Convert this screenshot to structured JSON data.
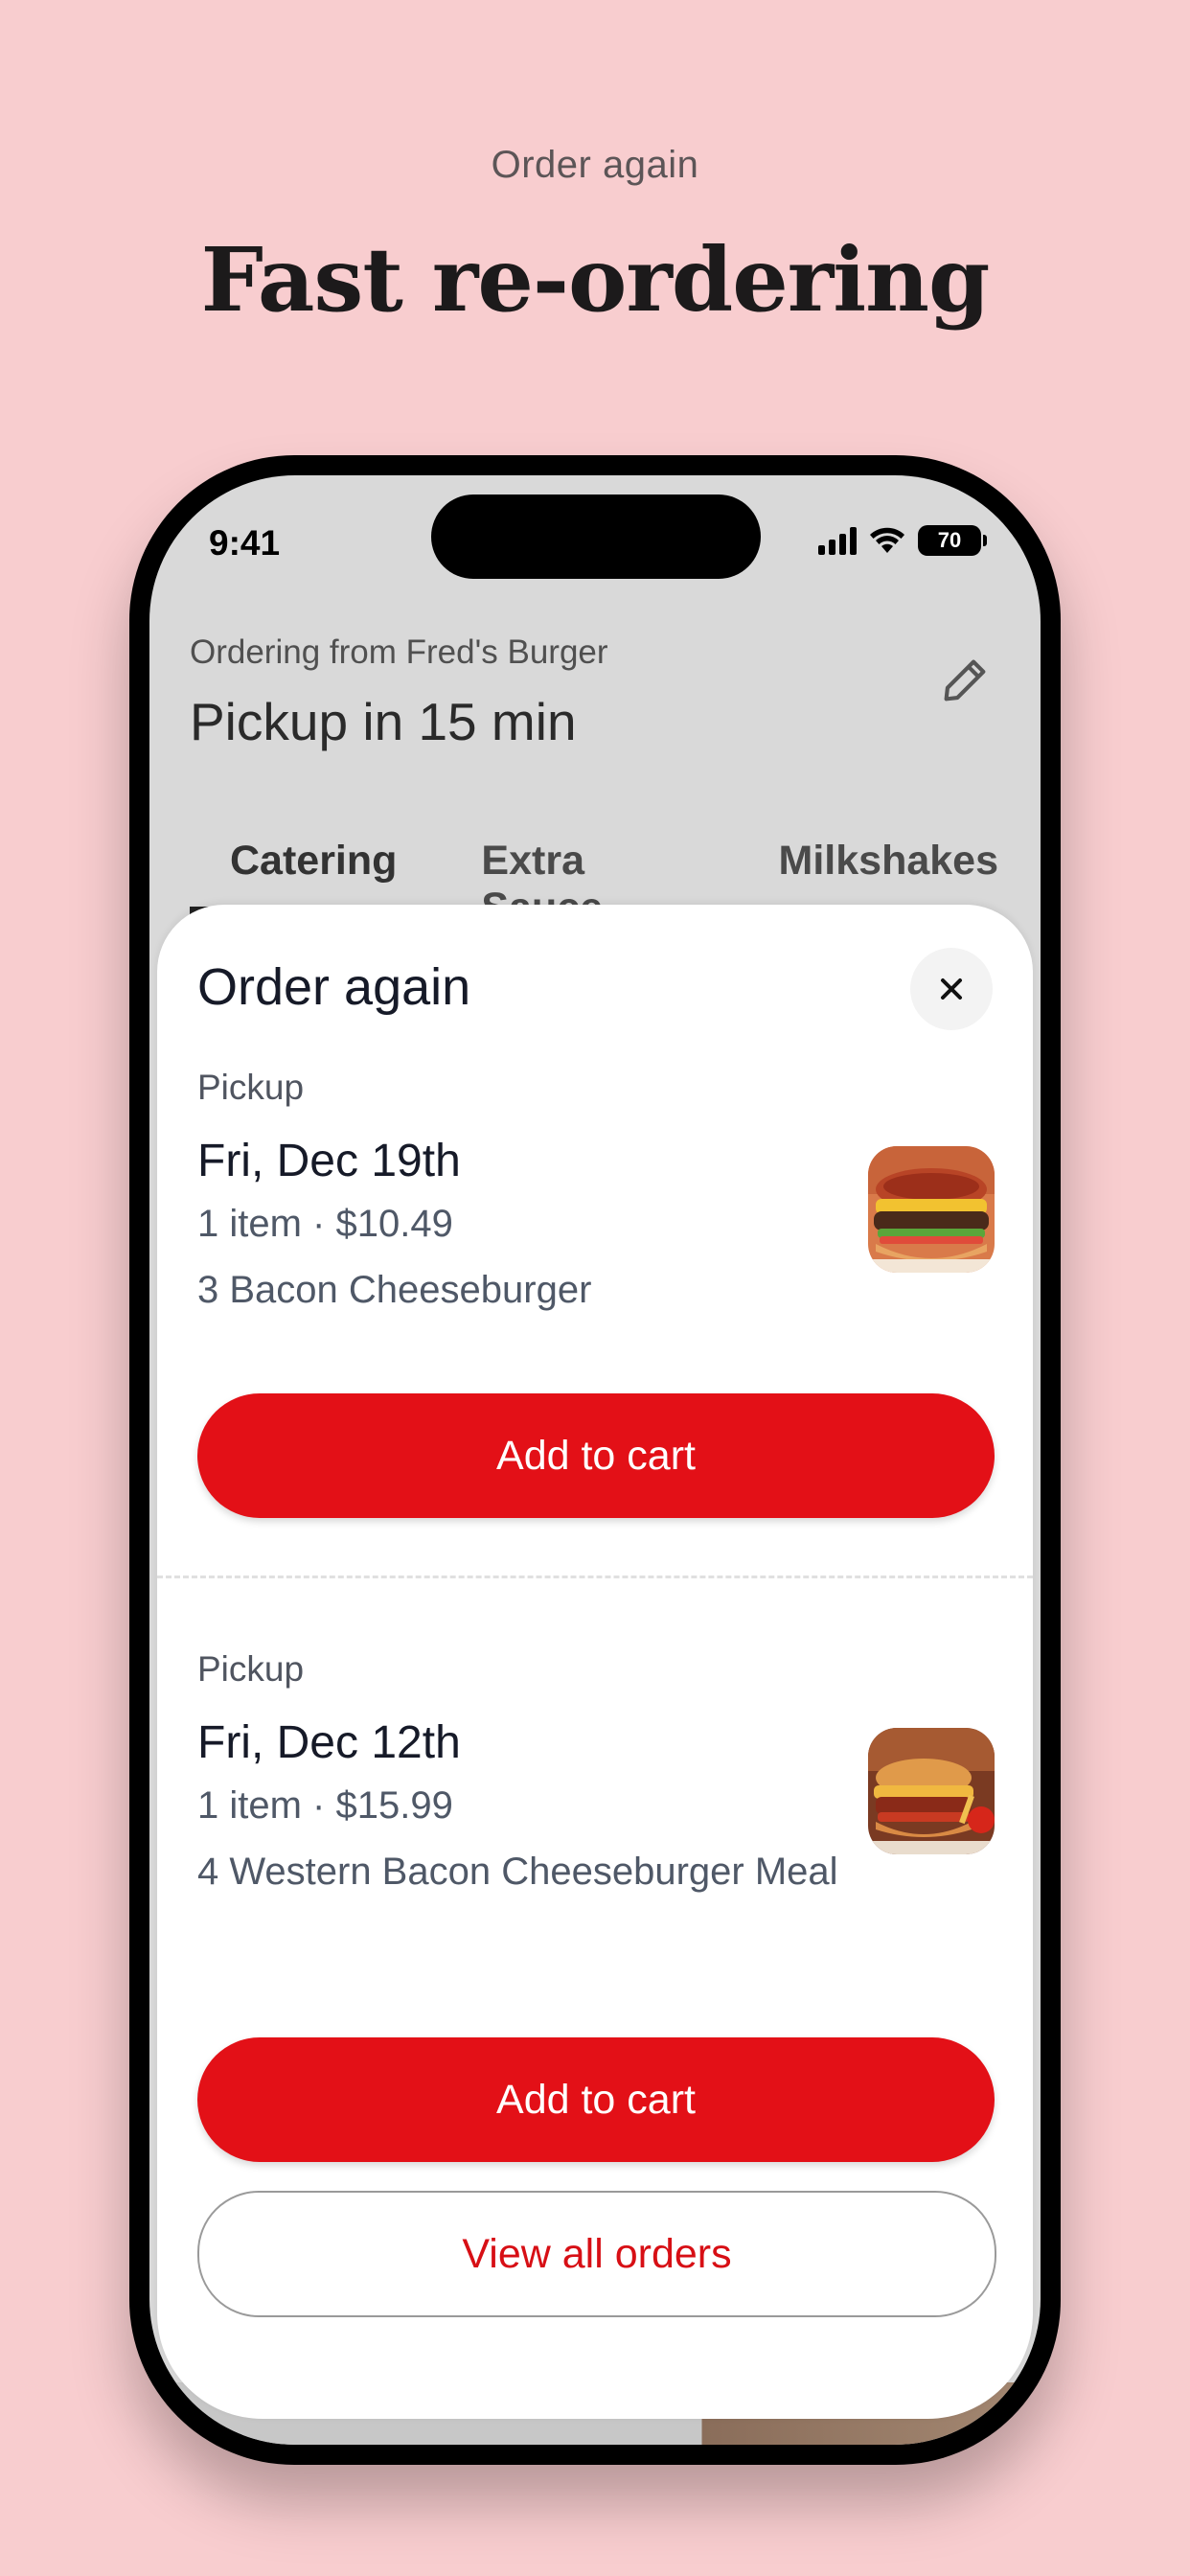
{
  "page": {
    "eyebrow": "Order again",
    "headline": "Fast re-ordering"
  },
  "status_bar": {
    "time": "9:41",
    "battery": "70",
    "icons": [
      "signal-icon",
      "wifi-icon",
      "battery-icon"
    ]
  },
  "header": {
    "ordering_from": "Ordering from Fred's Burger",
    "pickup_time": "Pickup in 15 min",
    "edit_icon": "pencil-icon"
  },
  "tabs": [
    {
      "label": "Catering"
    },
    {
      "label": "Extra Sauce"
    },
    {
      "label": "Milkshakes"
    }
  ],
  "sheet": {
    "title": "Order again",
    "close_icon": "close-icon",
    "orders": [
      {
        "type": "Pickup",
        "date": "Fri, Dec 19th",
        "meta": "1 item · $10.49",
        "items": "3 Bacon Cheeseburger",
        "cta": "Add to cart"
      },
      {
        "type": "Pickup",
        "date": "Fri, Dec 12th",
        "meta": "1 item · $15.99",
        "items": "4 Western Bacon Cheeseburger Meal",
        "cta": "Add to cart"
      }
    ],
    "view_all": "View all orders"
  },
  "colors": {
    "background": "#f8cdcf",
    "accent_red": "#e31017",
    "link_red": "#d70f15"
  }
}
